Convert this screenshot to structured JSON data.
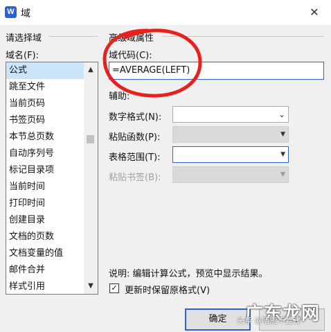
{
  "window": {
    "title": "域",
    "app_icon_letter": "W",
    "close_glyph": "✕"
  },
  "left_group": {
    "title": "请选择域",
    "list_label": "域名(F):",
    "items": [
      "公式",
      "跳至文件",
      "当前页码",
      "书签页码",
      "本节总页数",
      "自动序列号",
      "标记目录项",
      "当前时间",
      "打印时间",
      "创建目录",
      "文档的页数",
      "文档变量的值",
      "邮件合并",
      "样式引用"
    ],
    "selected_index": 0
  },
  "right_group": {
    "title": "高级域属性",
    "code_label": "域代码(C):",
    "code_value": "=AVERAGE(LEFT)",
    "aux_label": "辅助:",
    "rows": [
      {
        "label": "数字格式(N):",
        "value": "",
        "state": "enabled"
      },
      {
        "label": "粘贴函数(P):",
        "value": "",
        "state": "disabled"
      },
      {
        "label": "表格范围(T):",
        "value": "",
        "state": "focused"
      },
      {
        "label": "粘贴书签(B):",
        "value": "",
        "state": "disabled"
      }
    ]
  },
  "note": "说明: 编辑计算公式，预览中显示结果。",
  "checkbox": {
    "label": "更新时保留原格式(V)",
    "checked": true
  },
  "buttons": {
    "ok": "确定"
  },
  "watermark": {
    "large": "广东龙网",
    "small": "头条 @喵能不要钱"
  },
  "colors": {
    "accent": "#2b62d9",
    "annotation": "#e8211c",
    "selected_item": "#cce4f7"
  }
}
